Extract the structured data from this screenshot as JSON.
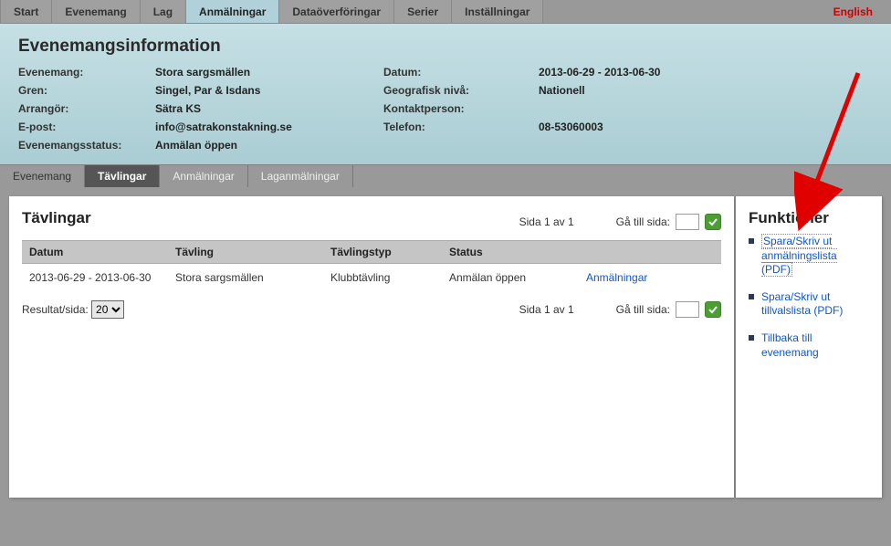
{
  "topnav": {
    "tabs": [
      "Start",
      "Evenemang",
      "Lag",
      "Anmälningar",
      "Dataöverföringar",
      "Serier",
      "Inställningar"
    ],
    "active_index": 3,
    "language_switch": "English"
  },
  "infopanel": {
    "heading": "Evenemangsinformation",
    "rows": [
      {
        "l1": "Evenemang:",
        "v1": "Stora sargsmällen",
        "l2": "Datum:",
        "v2": "2013-06-29 - 2013-06-30"
      },
      {
        "l1": "Gren:",
        "v1": "Singel, Par & Isdans",
        "l2": "Geografisk nivå:",
        "v2": "Nationell"
      },
      {
        "l1": "Arrangör:",
        "v1": "Sätra KS",
        "l2": "Kontaktperson:",
        "v2": ""
      },
      {
        "l1": "E-post:",
        "v1": "info@satrakonstakning.se",
        "l2": "Telefon:",
        "v2": "08-53060003"
      },
      {
        "l1": "Evenemangsstatus:",
        "v1": "Anmälan öppen",
        "l2": "",
        "v2": ""
      }
    ]
  },
  "subtabs": {
    "items": [
      "Evenemang",
      "Tävlingar",
      "Anmälningar",
      "Laganmälningar"
    ],
    "active_index": 1
  },
  "competitions": {
    "heading": "Tävlingar",
    "page_info_top": "Sida 1 av 1",
    "goto_label": "Gå till sida:",
    "columns": [
      "Datum",
      "Tävling",
      "Tävlingstyp",
      "Status",
      ""
    ],
    "rows": [
      {
        "date": "2013-06-29 - 2013-06-30",
        "name": "Stora sargsmällen",
        "type": "Klubbtävling",
        "status": "Anmälan öppen",
        "action": "Anmälningar"
      }
    ],
    "page_info_bottom": "Sida 1 av 1",
    "results_per_page_label": "Resultat/sida:",
    "results_per_page_value": "20"
  },
  "functions": {
    "heading": "Funktioner",
    "items": [
      "Spara/Skriv ut anmälningslista (PDF)",
      "Spara/Skriv ut tillvalslista (PDF)",
      "Tillbaka till evenemang"
    ]
  }
}
